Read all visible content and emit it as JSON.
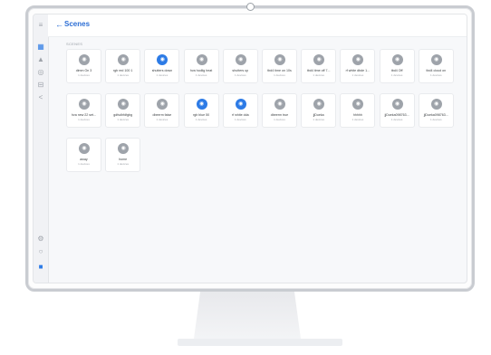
{
  "header": {
    "back_icon": "arrow-left-icon",
    "title": "Scenes"
  },
  "rail": {
    "icons": [
      "menu-icon",
      "home-icon",
      "devices-icon",
      "scenes-icon",
      "automation-icon",
      "settings-icon",
      "help-icon",
      "user-icon"
    ]
  },
  "section_label": "SCENES",
  "colors": {
    "accent": "#2d7be6",
    "inactive_icon": "#9ea3aa",
    "card_bg": "#ffffff"
  },
  "scenes": [
    {
      "name": "dimm Ón 3",
      "sub": "1 devices",
      "active": false
    },
    {
      "name": "rgb red 100 1",
      "sub": "1 devices",
      "active": false
    },
    {
      "name": "shutters down",
      "sub": "1 devices",
      "active": true
    },
    {
      "name": "hva hodlig heat",
      "sub": "1 devices",
      "active": false
    },
    {
      "name": "shutters up",
      "sub": "1 devices",
      "active": false
    },
    {
      "name": "tbd4 time on 10s",
      "sub": "1 devices",
      "active": false
    },
    {
      "name": "tbd4 time off 7...",
      "sub": "1 devices",
      "active": false
    },
    {
      "name": "rf white dbde 1...",
      "sub": "1 devices",
      "active": false
    },
    {
      "name": "tbd4 Off",
      "sub": "1 devices",
      "active": false
    },
    {
      "name": "tbd4 cloud on",
      "sub": "1 devices",
      "active": false
    },
    {
      "name": "hva new 22 set...",
      "sub": "1 devices",
      "active": false
    },
    {
      "name": "gdfsdhfdfgbg",
      "sub": "1 devices",
      "active": false
    },
    {
      "name": "dbeerm false",
      "sub": "1 devices",
      "active": false
    },
    {
      "name": "rgb blue 50",
      "sub": "1 devices",
      "active": true
    },
    {
      "name": "rf white dda",
      "sub": "1 devices",
      "active": true
    },
    {
      "name": "dbeerm true",
      "sub": "1 devices",
      "active": false
    },
    {
      "name": "jjDueka",
      "sub": "1 devices",
      "active": false
    },
    {
      "name": "hhhhh",
      "sub": "1 devices",
      "active": false
    },
    {
      "name": "jjDueka098763...",
      "sub": "1 devices",
      "active": false
    },
    {
      "name": "jjDueka098763...",
      "sub": "1 devices",
      "active": false
    },
    {
      "name": "away",
      "sub": "1 devices",
      "active": false
    },
    {
      "name": "home",
      "sub": "1 devices",
      "active": false
    }
  ]
}
